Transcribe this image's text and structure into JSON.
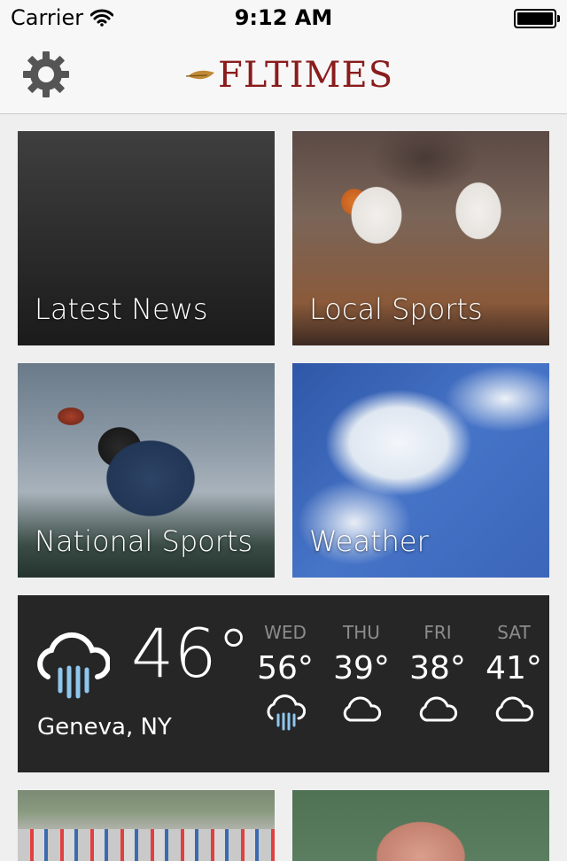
{
  "status_bar": {
    "carrier": "Carrier",
    "time": "9:12 AM",
    "wifi_icon": "wifi-icon",
    "battery_icon": "battery-icon"
  },
  "nav_bar": {
    "settings_icon": "gear-icon",
    "logo_text": "FLTIMES",
    "accent_color": "#8a1c1c"
  },
  "tiles": [
    {
      "label": "Latest News"
    },
    {
      "label": "Local Sports"
    },
    {
      "label": "National Sports"
    },
    {
      "label": "Weather"
    }
  ],
  "weather_widget": {
    "current_icon": "rain-cloud-icon",
    "current_temp": "46°",
    "city": "Geneva, NY",
    "forecast": [
      {
        "day": "WED",
        "temp": "56°",
        "icon": "rain-cloud-icon"
      },
      {
        "day": "THU",
        "temp": "39°",
        "icon": "cloud-icon"
      },
      {
        "day": "FRI",
        "temp": "38°",
        "icon": "cloud-icon"
      },
      {
        "day": "SAT",
        "temp": "41°",
        "icon": "cloud-icon"
      }
    ],
    "rain_color": "#8ec7ee"
  }
}
